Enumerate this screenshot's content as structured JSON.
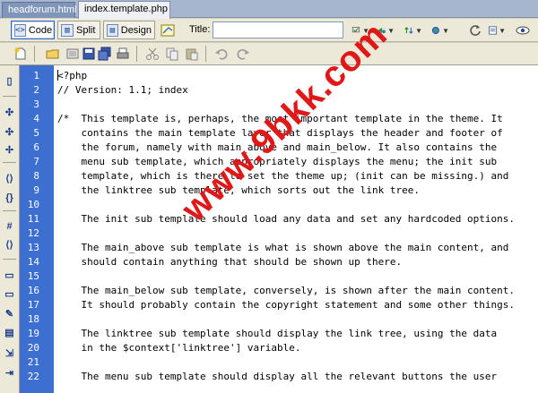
{
  "tabs": [
    {
      "label": "headforum.html",
      "active": false
    },
    {
      "label": "index.template.php",
      "active": true
    }
  ],
  "toolbar": {
    "code_label": "Code",
    "split_label": "Split",
    "design_label": "Design",
    "title_label": "Title:",
    "title_value": ""
  },
  "gutter": [
    "1",
    "2",
    "3",
    "4",
    "5",
    "6",
    "7",
    "8",
    "9",
    "10",
    "11",
    "12",
    "13",
    "14",
    "15",
    "16",
    "17",
    "18",
    "19",
    "20",
    "21",
    "22"
  ],
  "code_lines": [
    "<?php",
    "// Version: 1.1; index",
    "",
    "/*  This template is, perhaps, the most important template in the theme. It",
    "    contains the main template layer that displays the header and footer of",
    "    the forum, namely with main_above and main_below. It also contains the",
    "    menu sub template, which appropriately displays the menu; the init sub",
    "    template, which is there to set the theme up; (init can be missing.) and",
    "    the linktree sub template, which sorts out the link tree.",
    "",
    "    The init sub template should load any data and set any hardcoded options.",
    "",
    "    The main_above sub template is what is shown above the main content, and",
    "    should contain anything that should be shown up there.",
    "",
    "    The main_below sub template, conversely, is shown after the main content.",
    "    It should probably contain the copyright statement and some other things.",
    "",
    "    The linktree sub template should display the link tree, using the data",
    "    in the $context['linktree'] variable.",
    "",
    "    The menu sub template should display all the relevant buttons the user"
  ],
  "watermark": "www.9bkk.com",
  "colors": {
    "gutter": "#3c6fd0",
    "watermark": "#e01818"
  }
}
